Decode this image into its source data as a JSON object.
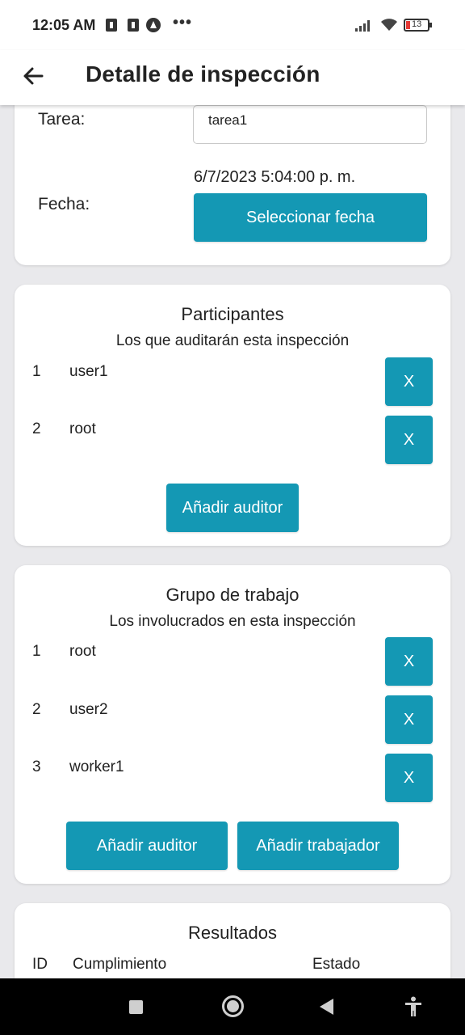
{
  "status_bar": {
    "time": "12:05 AM",
    "dots": "•••",
    "battery": "13"
  },
  "header": {
    "title": "Detalle de inspección",
    "back_icon": "arrow-left-icon"
  },
  "info": {
    "task_label": "Tarea:",
    "task_value": "tarea1",
    "date_label": "Fecha:",
    "date_value": "6/7/2023 5:04:00 p. m.",
    "select_date_label": "Seleccionar fecha"
  },
  "participants": {
    "title": "Participantes",
    "subtitle": "Los que auditarán esta inspección",
    "items": [
      {
        "num": "1",
        "name": "user1",
        "remove": "X"
      },
      {
        "num": "2",
        "name": "root",
        "remove": "X"
      }
    ],
    "add_auditor_label": "Añadir auditor"
  },
  "work_group": {
    "title": "Grupo de trabajo",
    "subtitle": "Los involucrados en esta inspección",
    "items": [
      {
        "num": "1",
        "name": "root",
        "remove": "X"
      },
      {
        "num": "2",
        "name": "user2",
        "remove": "X"
      },
      {
        "num": "3",
        "name": "worker1",
        "remove": "X"
      }
    ],
    "add_auditor_label": "Añadir auditor",
    "add_worker_label": "Añadir trabajador"
  },
  "results": {
    "title": "Resultados",
    "columns": [
      "ID",
      "Cumplimiento",
      "Estado"
    ]
  },
  "colors": {
    "accent": "#1498b4",
    "background": "#e9e9ec",
    "card": "#ffffff"
  }
}
